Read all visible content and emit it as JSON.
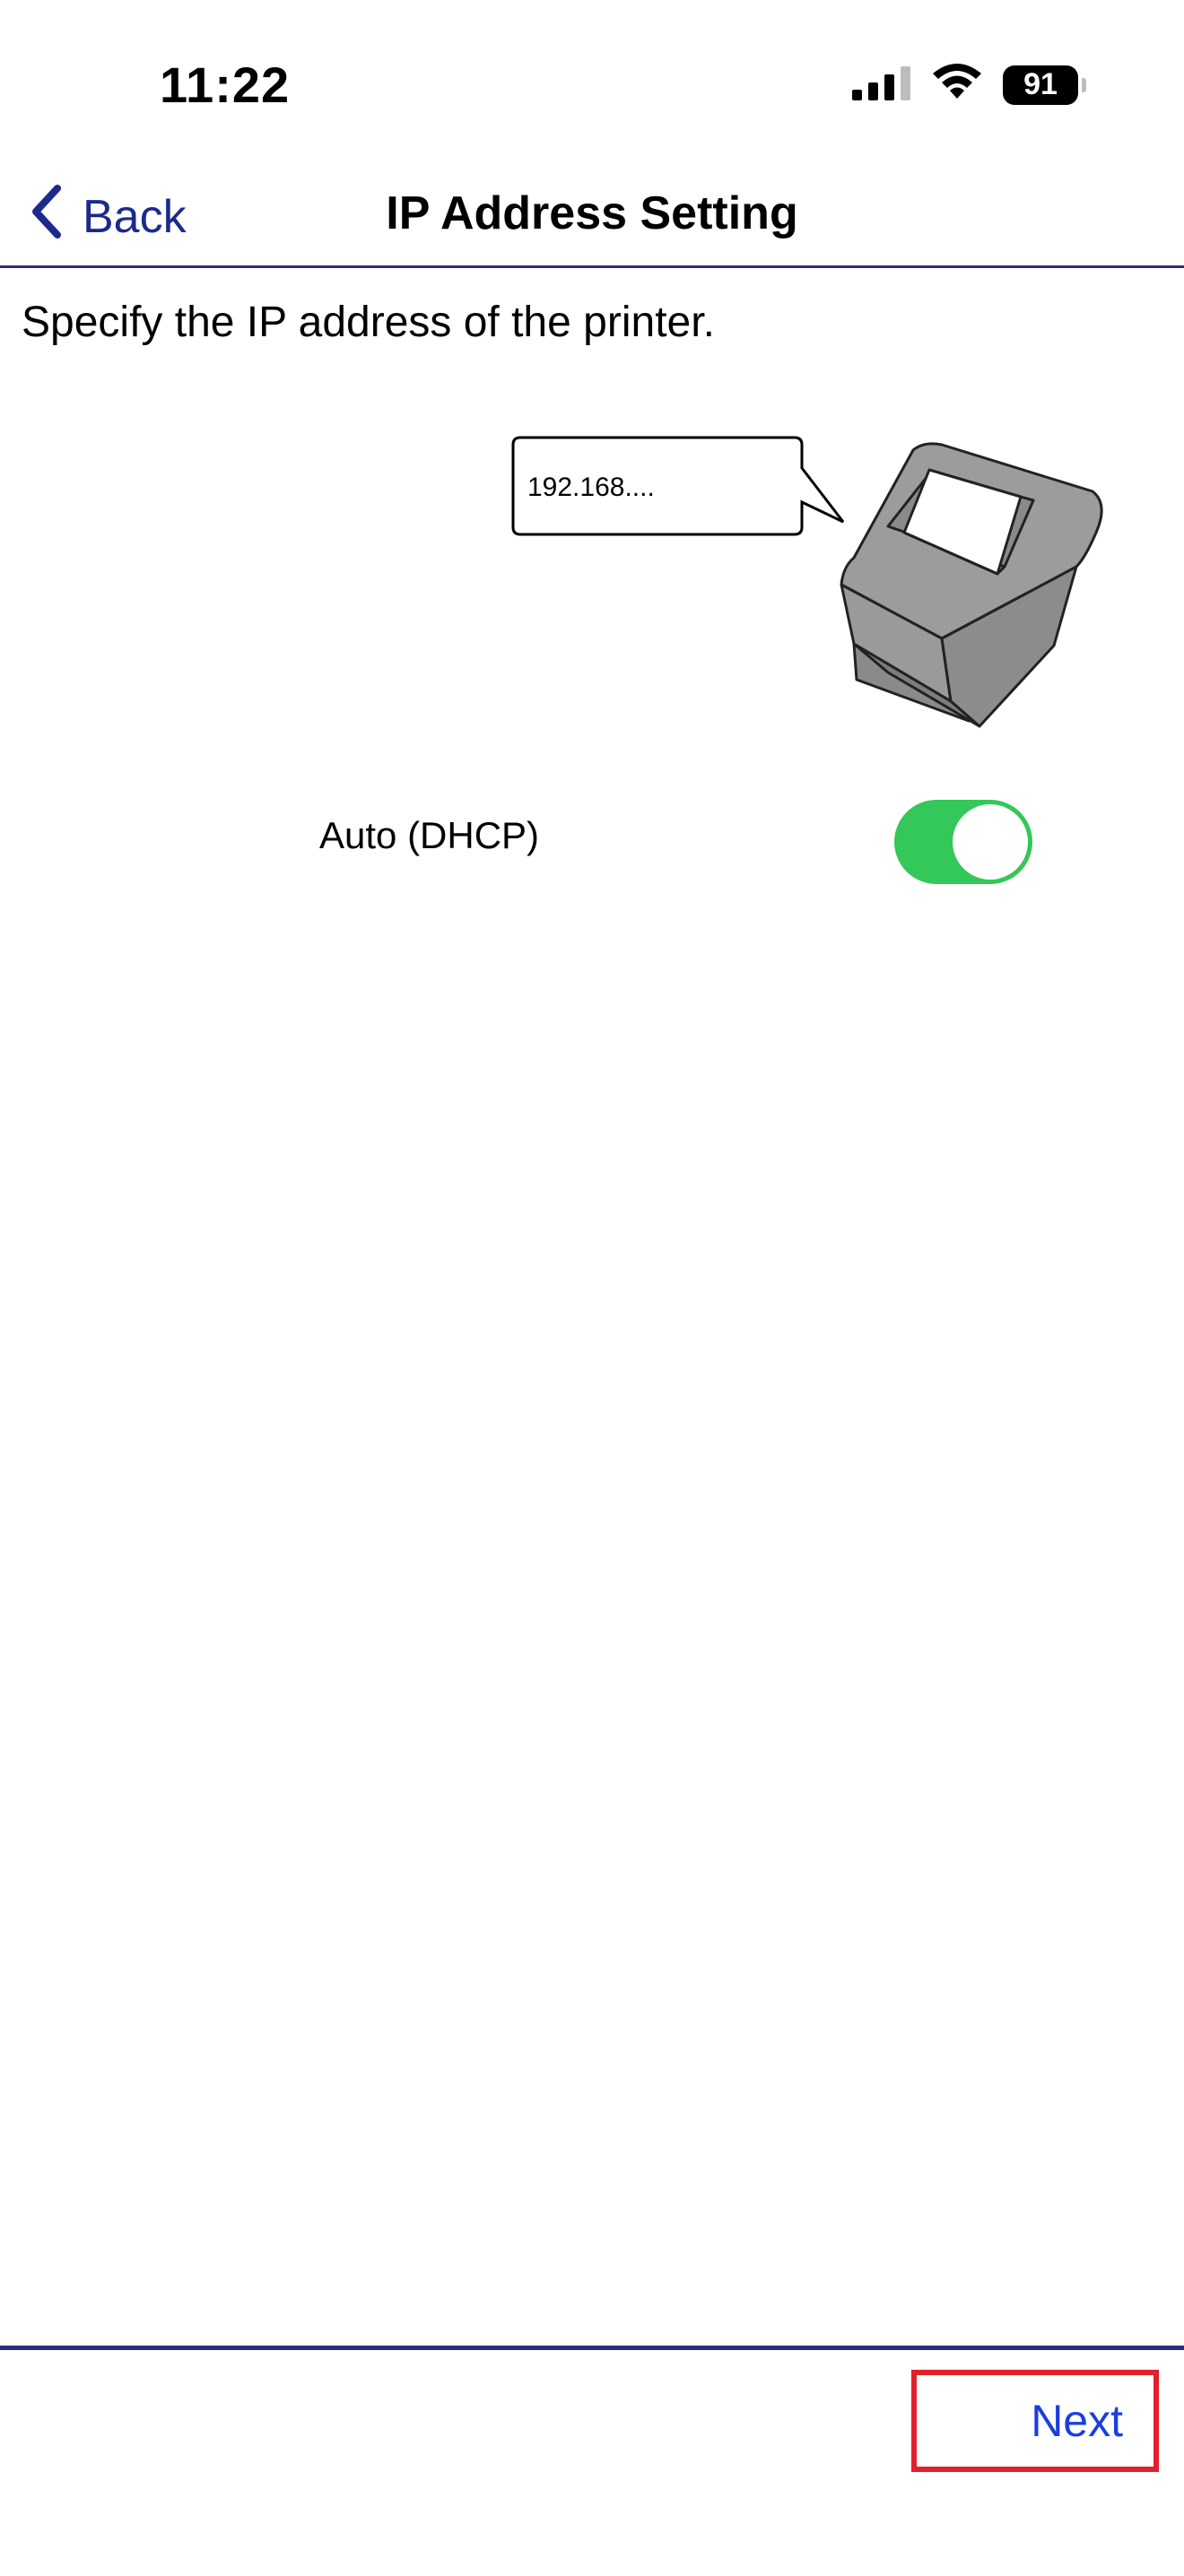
{
  "status_bar": {
    "time": "11:22",
    "battery_level": "91",
    "icons": [
      "cellular-signal-icon",
      "wifi-icon",
      "battery-icon"
    ]
  },
  "nav": {
    "back_label": "Back",
    "title": "IP Address Setting"
  },
  "content": {
    "instruction": "Specify the IP address of the printer.",
    "illustration": {
      "speech_bubble_text": "192.168....",
      "icon": "printer-icon"
    },
    "dhcp": {
      "label": "Auto (DHCP)",
      "enabled": true
    }
  },
  "footer": {
    "next_label": "Next"
  },
  "colors": {
    "accent_blue": "#1c2a8c",
    "next_blue": "#1b3de0",
    "toggle_on": "#34c759",
    "divider": "#2a2f7a",
    "highlight_red": "#e0202a"
  }
}
